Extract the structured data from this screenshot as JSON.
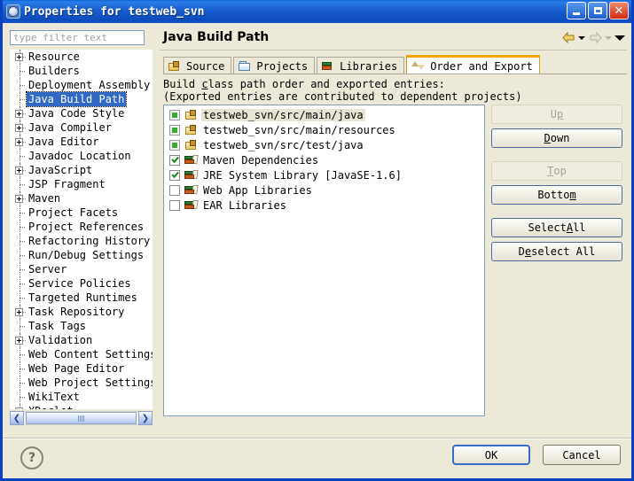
{
  "window": {
    "title": "Properties for testweb_svn",
    "icon": "properties-gear-icon",
    "minimize_label": "",
    "maximize_label": "",
    "close_label": "✕"
  },
  "filter": {
    "placeholder": "type filter text",
    "value": ""
  },
  "tree": {
    "items": [
      {
        "label": "Resource",
        "expandable": true,
        "selected": false
      },
      {
        "label": "Builders",
        "expandable": false,
        "selected": false
      },
      {
        "label": "Deployment Assembly",
        "expandable": false,
        "selected": false
      },
      {
        "label": "Java Build Path",
        "expandable": false,
        "selected": true
      },
      {
        "label": "Java Code Style",
        "expandable": true,
        "selected": false
      },
      {
        "label": "Java Compiler",
        "expandable": true,
        "selected": false
      },
      {
        "label": "Java Editor",
        "expandable": true,
        "selected": false
      },
      {
        "label": "Javadoc Location",
        "expandable": false,
        "selected": false
      },
      {
        "label": "JavaScript",
        "expandable": true,
        "selected": false
      },
      {
        "label": "JSP Fragment",
        "expandable": false,
        "selected": false
      },
      {
        "label": "Maven",
        "expandable": true,
        "selected": false
      },
      {
        "label": "Project Facets",
        "expandable": false,
        "selected": false
      },
      {
        "label": "Project References",
        "expandable": false,
        "selected": false
      },
      {
        "label": "Refactoring History",
        "expandable": false,
        "selected": false
      },
      {
        "label": "Run/Debug Settings",
        "expandable": false,
        "selected": false
      },
      {
        "label": "Server",
        "expandable": false,
        "selected": false
      },
      {
        "label": "Service Policies",
        "expandable": false,
        "selected": false
      },
      {
        "label": "Targeted Runtimes",
        "expandable": false,
        "selected": false
      },
      {
        "label": "Task Repository",
        "expandable": true,
        "selected": false
      },
      {
        "label": "Task Tags",
        "expandable": false,
        "selected": false
      },
      {
        "label": "Validation",
        "expandable": true,
        "selected": false
      },
      {
        "label": "Web Content Settings",
        "expandable": false,
        "selected": false
      },
      {
        "label": "Web Page Editor",
        "expandable": false,
        "selected": false
      },
      {
        "label": "Web Project Settings",
        "expandable": false,
        "selected": false
      },
      {
        "label": "WikiText",
        "expandable": false,
        "selected": false
      },
      {
        "label": "XDoclet",
        "expandable": true,
        "selected": false
      }
    ],
    "scroll_left_label": "❮",
    "scroll_right_label": "❯"
  },
  "page": {
    "title": "Java Build Path",
    "nav": {
      "back_icon": "back-arrow-icon",
      "back_dropdown_icon": "chevron-down-icon",
      "forward_icon": "forward-arrow-icon",
      "forward_dropdown_icon": "chevron-down-icon",
      "menu_icon": "chevron-down-icon"
    }
  },
  "tabs": [
    {
      "label": "Source",
      "icon": "source-folder-icon",
      "active": false
    },
    {
      "label": "Projects",
      "icon": "project-folder-icon",
      "active": false
    },
    {
      "label": "Libraries",
      "icon": "libraries-books-icon",
      "active": false
    },
    {
      "label": "Order and Export",
      "icon": "order-export-arrows-icon",
      "active": true
    }
  ],
  "description": {
    "line1_pre": "Build ",
    "line1_mnemonic": "c",
    "line1_post": "lass path order and exported entries:",
    "line2": "(Exported entries are contributed to dependent projects)"
  },
  "entries": [
    {
      "label": "testweb_svn/src/main/java",
      "state": "grayed",
      "icon": "source-package-icon",
      "selected": true
    },
    {
      "label": "testweb_svn/src/main/resources",
      "state": "grayed",
      "icon": "source-package-icon",
      "selected": false
    },
    {
      "label": "testweb_svn/src/test/java",
      "state": "grayed",
      "icon": "source-package-icon",
      "selected": false
    },
    {
      "label": "Maven Dependencies",
      "state": "checked",
      "icon": "library-icon",
      "selected": false
    },
    {
      "label": "JRE System Library [JavaSE-1.6]",
      "state": "checked",
      "icon": "library-icon",
      "selected": false
    },
    {
      "label": "Web App Libraries",
      "state": "unchecked",
      "icon": "library-icon",
      "selected": false
    },
    {
      "label": "EAR Libraries",
      "state": "unchecked",
      "icon": "library-icon",
      "selected": false
    }
  ],
  "side_buttons": [
    {
      "label": "Up",
      "mnemonic": "p",
      "enabled": false
    },
    {
      "label": "Down",
      "mnemonic": "D",
      "enabled": true
    },
    {
      "label": "Top",
      "mnemonic": "T",
      "enabled": false
    },
    {
      "label": "Bottom",
      "mnemonic": "m",
      "enabled": true
    },
    {
      "label": "Select All",
      "mnemonic": "A",
      "enabled": true
    },
    {
      "label": "Deselect All",
      "mnemonic": "e",
      "enabled": true
    }
  ],
  "footer": {
    "help_label": "?",
    "ok_label": "OK",
    "cancel_label": "Cancel"
  }
}
